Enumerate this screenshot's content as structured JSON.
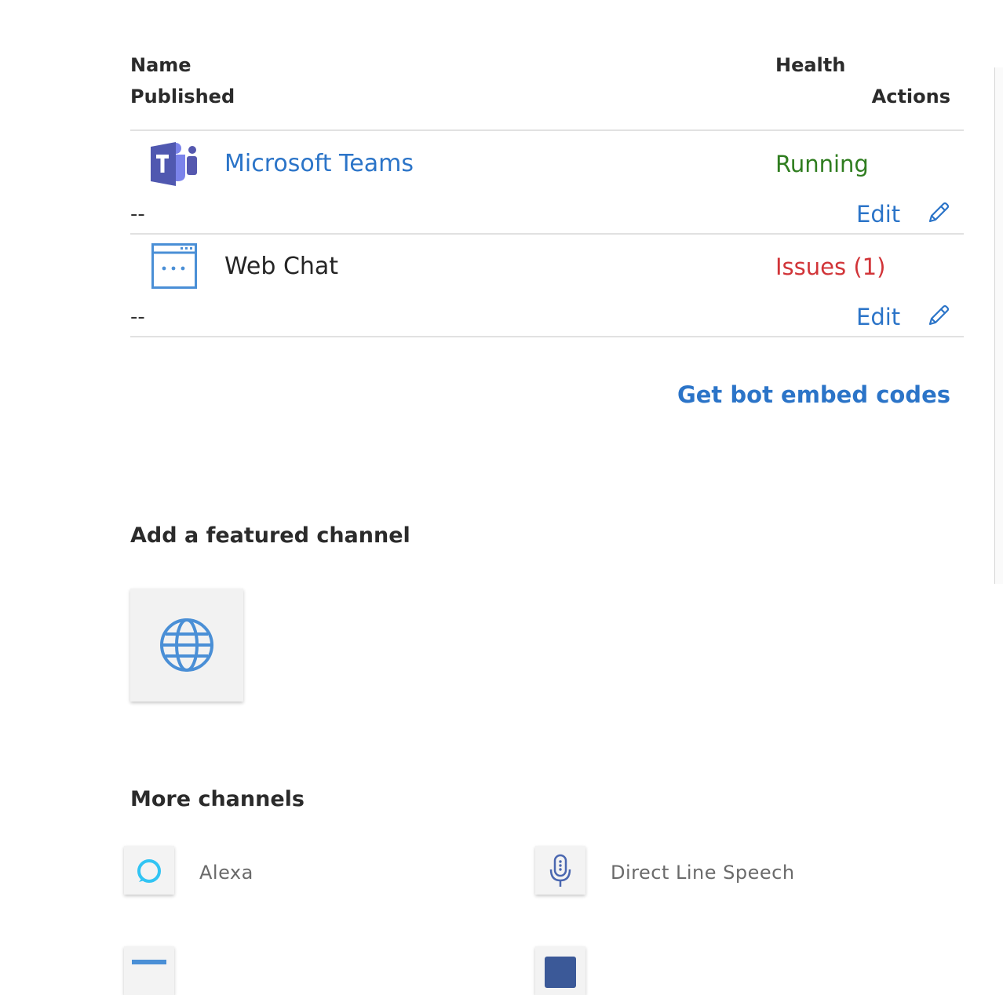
{
  "table": {
    "headers": {
      "name": "Name",
      "health": "Health",
      "published": "Published",
      "actions": "Actions"
    },
    "rows": [
      {
        "name": "Microsoft Teams",
        "icon": "microsoft-teams-icon",
        "health": "Running",
        "health_color": "#2f7d1f",
        "published": "--",
        "edit_label": "Edit"
      },
      {
        "name": "Web Chat",
        "icon": "web-chat-icon",
        "health": "Issues (1)",
        "health_color": "#d13438",
        "published": "--",
        "edit_label": "Edit"
      }
    ]
  },
  "embed_link": "Get bot embed codes",
  "featured": {
    "title": "Add a featured channel",
    "tile_icon": "globe-icon"
  },
  "more_channels": {
    "title": "More channels",
    "items": [
      {
        "label": "Alexa",
        "icon": "alexa-icon"
      },
      {
        "label": "Direct Line Speech",
        "icon": "microphone-icon"
      }
    ]
  },
  "colors": {
    "link": "#2b74c8",
    "teams_purple": "#5558af",
    "icon_blue": "#4a8fd6"
  }
}
